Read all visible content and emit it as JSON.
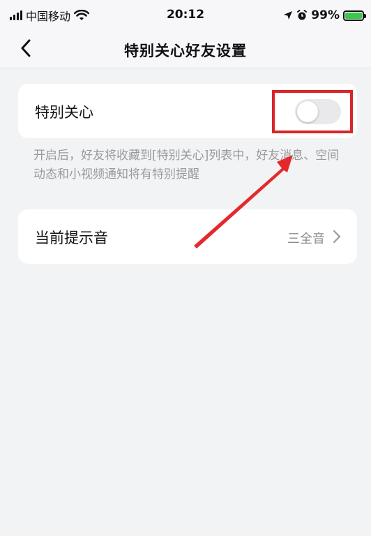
{
  "status_bar": {
    "carrier": "中国移动",
    "time": "20:12",
    "battery": "99%"
  },
  "nav": {
    "title": "特别关心好友设置"
  },
  "special_care": {
    "label": "特别关心",
    "toggle_on": false,
    "description": "开启后，好友将收藏到[特别关心]列表中，好友消息、空间动态和小视频通知将有特别提醒"
  },
  "tone": {
    "label": "当前提示音",
    "value": "三全音"
  },
  "colors": {
    "highlight": "#d8262a",
    "battery_fill": "#3ac94a",
    "background": "#f2f3f5"
  }
}
